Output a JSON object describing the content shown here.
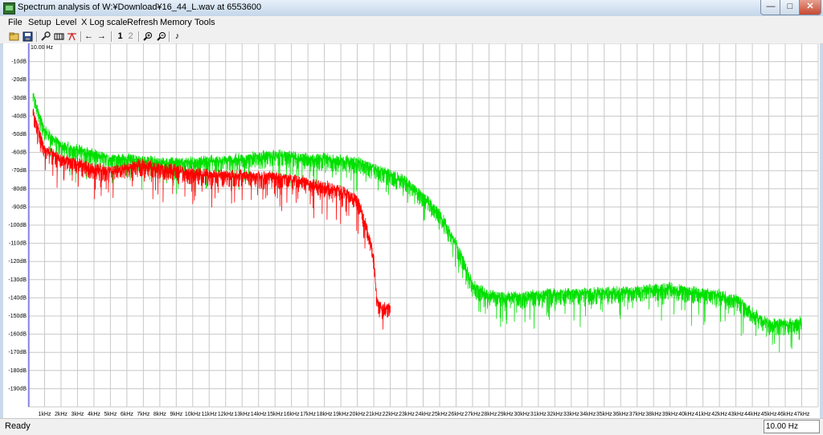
{
  "window": {
    "title": "Spectrum analysis of W:¥Download¥16_44_L.wav at 6553600",
    "minimize_icon": "minimize-icon",
    "maximize_icon": "maximize-icon",
    "close_icon": "close-icon"
  },
  "menu": [
    "File",
    "Setup",
    "Level",
    "X Log scale",
    "Refresh",
    "Memory",
    "Tools"
  ],
  "toolbar": {
    "icons": [
      "wrench-icon",
      "save-icon",
      "settings-icon",
      "display-icon",
      "filter-icon",
      "arrow-left-icon",
      "arrow-right-icon",
      "memory-1-icon",
      "memory-2-icon",
      "zoom-in-icon",
      "zoom-out-icon",
      "note-icon"
    ],
    "arrow_left": "←",
    "arrow_right": "→",
    "mem1": "1",
    "mem2": "2",
    "note": "♪"
  },
  "status": {
    "text": "Ready",
    "frequency": "10.00 Hz"
  },
  "chart_data": {
    "type": "line",
    "cursor_label": "10.00 Hz",
    "x_unit": "kHz",
    "x_categories": [
      "1kHz",
      "2kHz",
      "3kHz",
      "4kHz",
      "5kHz",
      "6kHz",
      "7kHz",
      "8kHz",
      "9kHz",
      "10kHz",
      "11kHz",
      "12kHz",
      "13kHz",
      "14kHz",
      "15kHz",
      "16kHz",
      "17kHz",
      "18kHz",
      "19kHz",
      "20kHz",
      "21kHz",
      "22kHz",
      "23kHz",
      "24kHz",
      "25kHz",
      "26kHz",
      "27kHz",
      "28kHz",
      "29kHz",
      "30kHz",
      "31kHz",
      "32kHz",
      "33kHz",
      "34kHz",
      "35kHz",
      "36kHz",
      "37kHz",
      "38kHz",
      "39kHz",
      "40kHz",
      "41kHz",
      "42kHz",
      "43kHz",
      "44kHz",
      "45kHz",
      "46kHz",
      "47kHz"
    ],
    "y_ticks": [
      "-10dB",
      "-20dB",
      "-30dB",
      "-40dB",
      "-50dB",
      "-60dB",
      "-70dB",
      "-80dB",
      "-90dB",
      "-100dB",
      "-110dB",
      "-120dB",
      "-130dB",
      "-140dB",
      "-150dB",
      "-160dB",
      "-170dB",
      "-180dB",
      "-190dB"
    ],
    "xlim": [
      0,
      48
    ],
    "ylim": [
      -200,
      0
    ],
    "grid": true,
    "series": [
      {
        "color": "#00e000",
        "x": [
          0.3,
          1,
          2,
          3,
          4,
          5,
          6,
          7,
          8,
          9,
          10,
          11,
          12,
          13,
          14,
          15,
          16,
          17,
          18,
          19,
          20,
          21,
          22,
          23,
          24,
          25,
          25.5,
          26,
          26.5,
          27,
          28,
          29,
          30,
          31,
          32,
          33,
          34,
          35,
          36,
          37,
          38,
          39,
          40,
          41,
          42,
          43,
          44,
          45,
          46,
          47
        ],
        "y": [
          -30,
          -50,
          -58,
          -60,
          -63,
          -65,
          -65,
          -66,
          -67,
          -67,
          -67,
          -66,
          -66,
          -65,
          -64,
          -63,
          -64,
          -65,
          -65,
          -66,
          -67,
          -70,
          -74,
          -78,
          -86,
          -95,
          -104,
          -112,
          -122,
          -135,
          -140,
          -141,
          -141,
          -140,
          -139,
          -139,
          -139,
          -139,
          -138,
          -138,
          -137,
          -136,
          -138,
          -139,
          -140,
          -142,
          -150,
          -156,
          -156,
          -155
        ]
      },
      {
        "color": "#ff0000",
        "x": [
          0.3,
          1,
          2,
          3,
          4,
          5,
          6,
          7,
          8,
          9,
          10,
          11,
          12,
          13,
          14,
          15,
          16,
          17,
          18,
          19,
          20,
          20.5,
          21,
          21.2,
          21.5,
          22
        ],
        "y": [
          -40,
          -60,
          -65,
          -68,
          -70,
          -72,
          -70,
          -68,
          -70,
          -71,
          -73,
          -74,
          -74,
          -74,
          -75,
          -75,
          -76,
          -78,
          -80,
          -82,
          -88,
          -100,
          -120,
          -145,
          -147,
          -146
        ]
      }
    ]
  }
}
